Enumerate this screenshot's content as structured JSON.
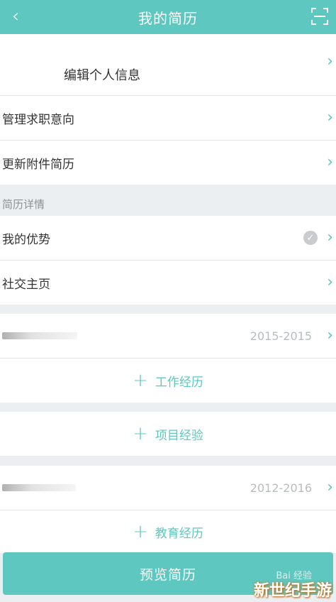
{
  "header": {
    "title": "我的简历"
  },
  "profile": {
    "edit_label": "编辑个人信息"
  },
  "menu": {
    "job_intention": "管理求职意向",
    "attachment": "更新附件简历"
  },
  "details": {
    "section_title": "简历详情",
    "advantage": "我的优势",
    "social": "社交主页"
  },
  "work": {
    "date_range": "2015-2015",
    "add_label": "工作经历"
  },
  "project": {
    "add_label": "项目经验"
  },
  "education": {
    "date_range": "2012-2016",
    "add_label": "教育经历"
  },
  "footer": {
    "preview_label": "预览简历"
  },
  "watermark": {
    "baidu": "Bai 经验",
    "site": "新世纪手游"
  },
  "colors": {
    "accent": "#5ec7bf",
    "background": "#eceff1"
  }
}
